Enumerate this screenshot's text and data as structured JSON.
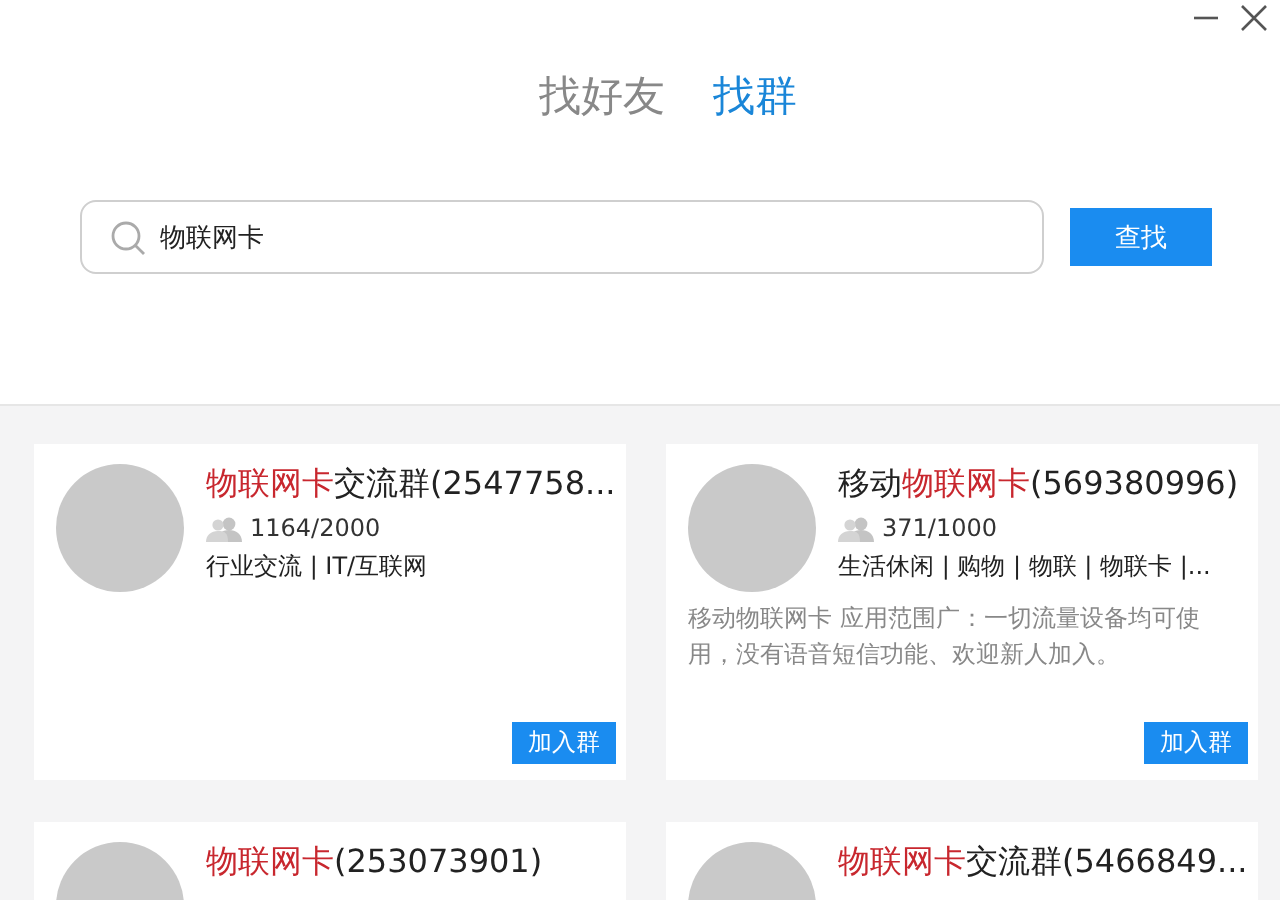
{
  "tabs": [
    {
      "label": "找好友",
      "selected": false
    },
    {
      "label": "找群",
      "selected": true
    }
  ],
  "search": {
    "value": "物联网卡",
    "button": "查找"
  },
  "results": [
    {
      "title_parts": [
        {
          "text": "物联网卡",
          "highlight": true
        },
        {
          "text": "交流群(2547758...",
          "highlight": false
        }
      ],
      "members": "1164/2000",
      "tags": "行业交流 | IT/互联网",
      "join": "加入群"
    },
    {
      "title_parts": [
        {
          "text": "移动",
          "highlight": false
        },
        {
          "text": "物联网卡",
          "highlight": true
        },
        {
          "text": "(569380996)",
          "highlight": false
        }
      ],
      "members": "371/1000",
      "tags": "生活休闲 | 购物 | 物联 | 物联卡 |...",
      "description": "移动物联网卡 应用范围广：一切流量设备均可使用，没有语音短信功能、欢迎新人加入。",
      "join": "加入群"
    },
    {
      "title_parts": [
        {
          "text": "物联网卡",
          "highlight": true
        },
        {
          "text": "(253073901)",
          "highlight": false
        }
      ]
    },
    {
      "title_parts": [
        {
          "text": "物联网卡",
          "highlight": true
        },
        {
          "text": "交流群(5466849...",
          "highlight": false
        }
      ]
    }
  ]
}
